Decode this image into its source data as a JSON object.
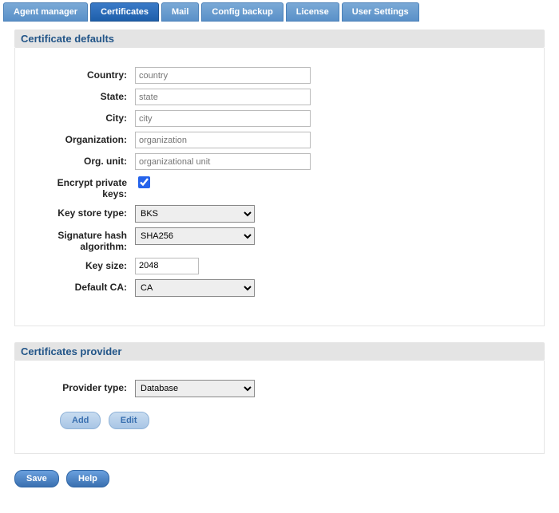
{
  "tabs": {
    "agent_manager": "Agent manager",
    "certificates": "Certificates",
    "mail": "Mail",
    "config_backup": "Config backup",
    "license": "License",
    "user_settings": "User Settings"
  },
  "panels": {
    "defaults": {
      "title": "Certificate defaults",
      "labels": {
        "country": "Country:",
        "state": "State:",
        "city": "City:",
        "organization": "Organization:",
        "org_unit": "Org. unit:",
        "encrypt_keys": "Encrypt private keys:",
        "key_store_type": "Key store type:",
        "sig_hash_alg": "Signature hash algorithm:",
        "key_size": "Key size:",
        "default_ca": "Default CA:"
      },
      "placeholders": {
        "country": "country",
        "state": "state",
        "city": "city",
        "organization": "organization",
        "org_unit": "organizational unit"
      },
      "values": {
        "country": "",
        "state": "",
        "city": "",
        "organization": "",
        "org_unit": "",
        "encrypt_keys": true,
        "key_store_type": "BKS",
        "sig_hash_alg": "SHA256",
        "key_size": "2048",
        "default_ca": "CA"
      }
    },
    "provider": {
      "title": "Certificates provider",
      "labels": {
        "provider_type": "Provider type:"
      },
      "values": {
        "provider_type": "Database"
      },
      "buttons": {
        "add": "Add",
        "edit": "Edit"
      }
    }
  },
  "footer": {
    "save": "Save",
    "help": "Help"
  }
}
